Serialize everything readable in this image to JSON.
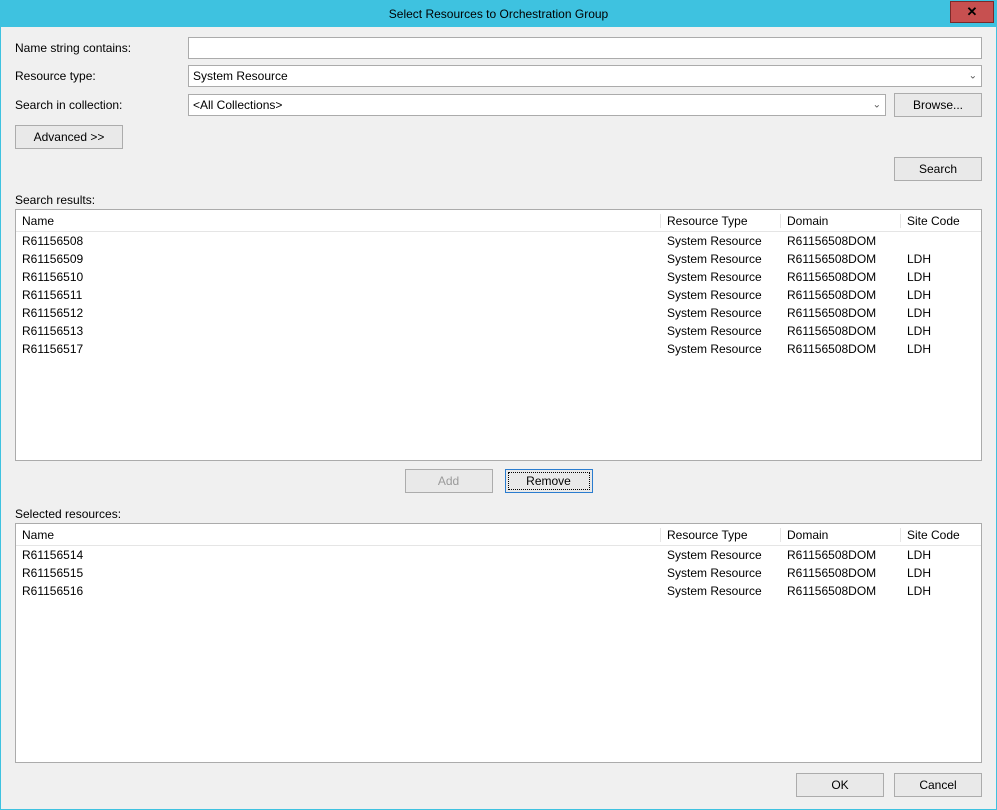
{
  "titlebar": {
    "title": "Select Resources to Orchestration Group",
    "close_label": "✕"
  },
  "form": {
    "name_label": "Name string contains:",
    "name_value": "",
    "type_label": "Resource type:",
    "type_value": "System Resource",
    "collection_label": "Search in collection:",
    "collection_value": "<All Collections>",
    "browse_label": "Browse...",
    "advanced_label": "Advanced >>",
    "search_label": "Search"
  },
  "results": {
    "section_label": "Search results:",
    "headers": {
      "name": "Name",
      "rtype": "Resource Type",
      "domain": "Domain",
      "site": "Site Code"
    },
    "rows": [
      {
        "name": "R61156508",
        "rtype": "System Resource",
        "domain": "R61156508DOM",
        "site": ""
      },
      {
        "name": "R61156509",
        "rtype": "System Resource",
        "domain": "R61156508DOM",
        "site": "LDH"
      },
      {
        "name": "R61156510",
        "rtype": "System Resource",
        "domain": "R61156508DOM",
        "site": "LDH"
      },
      {
        "name": "R61156511",
        "rtype": "System Resource",
        "domain": "R61156508DOM",
        "site": "LDH"
      },
      {
        "name": "R61156512",
        "rtype": "System Resource",
        "domain": "R61156508DOM",
        "site": "LDH"
      },
      {
        "name": "R61156513",
        "rtype": "System Resource",
        "domain": "R61156508DOM",
        "site": "LDH"
      },
      {
        "name": "R61156517",
        "rtype": "System Resource",
        "domain": "R61156508DOM",
        "site": "LDH"
      }
    ]
  },
  "buttons": {
    "add_label": "Add",
    "remove_label": "Remove"
  },
  "selected": {
    "section_label": "Selected resources:",
    "headers": {
      "name": "Name",
      "rtype": "Resource Type",
      "domain": "Domain",
      "site": "Site Code"
    },
    "rows": [
      {
        "name": "R61156514",
        "rtype": "System Resource",
        "domain": "R61156508DOM",
        "site": "LDH"
      },
      {
        "name": "R61156515",
        "rtype": "System Resource",
        "domain": "R61156508DOM",
        "site": "LDH"
      },
      {
        "name": "R61156516",
        "rtype": "System Resource",
        "domain": "R61156508DOM",
        "site": "LDH"
      }
    ]
  },
  "dialog": {
    "ok_label": "OK",
    "cancel_label": "Cancel"
  }
}
